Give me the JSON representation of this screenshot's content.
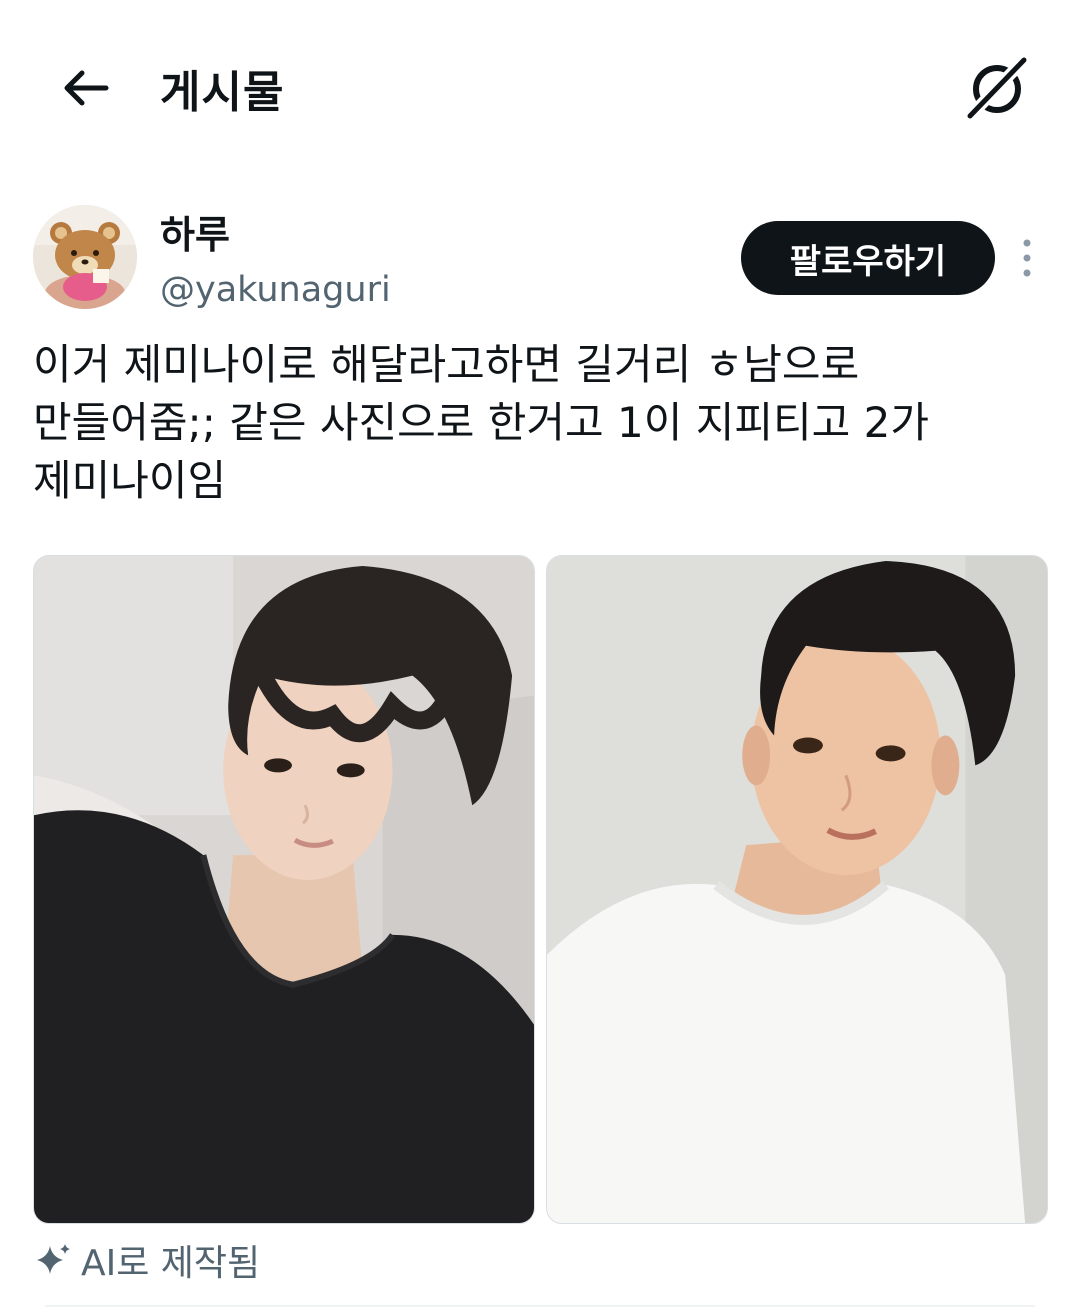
{
  "header": {
    "title": "게시물",
    "back_icon": "arrow-left-icon",
    "grok_icon": "grok-icon"
  },
  "author": {
    "display_name": "하루",
    "handle": "@yakunaguri",
    "avatar": "teddy-bear-plush-avatar"
  },
  "actions": {
    "follow_label": "팔로우하기",
    "more_icon": "more-vertical-icon"
  },
  "tweet": {
    "text": "이거 제미나이로 해달라고하면 길거리 ㅎ남으로\n만들어줌;; 같은 사진으로 한거고 1이 지피티고 2가\n제미나이임"
  },
  "media": [
    {
      "subject": "young man in black t-shirt selfie"
    },
    {
      "subject": "young man in white t-shirt selfie"
    }
  ],
  "ai_label": {
    "icon": "sparkle-icon",
    "text": "AI로 제작됨"
  },
  "colors": {
    "text_primary": "#0f1419",
    "text_secondary": "#536471",
    "follow_bg": "#0f1419",
    "follow_text": "#ffffff"
  }
}
